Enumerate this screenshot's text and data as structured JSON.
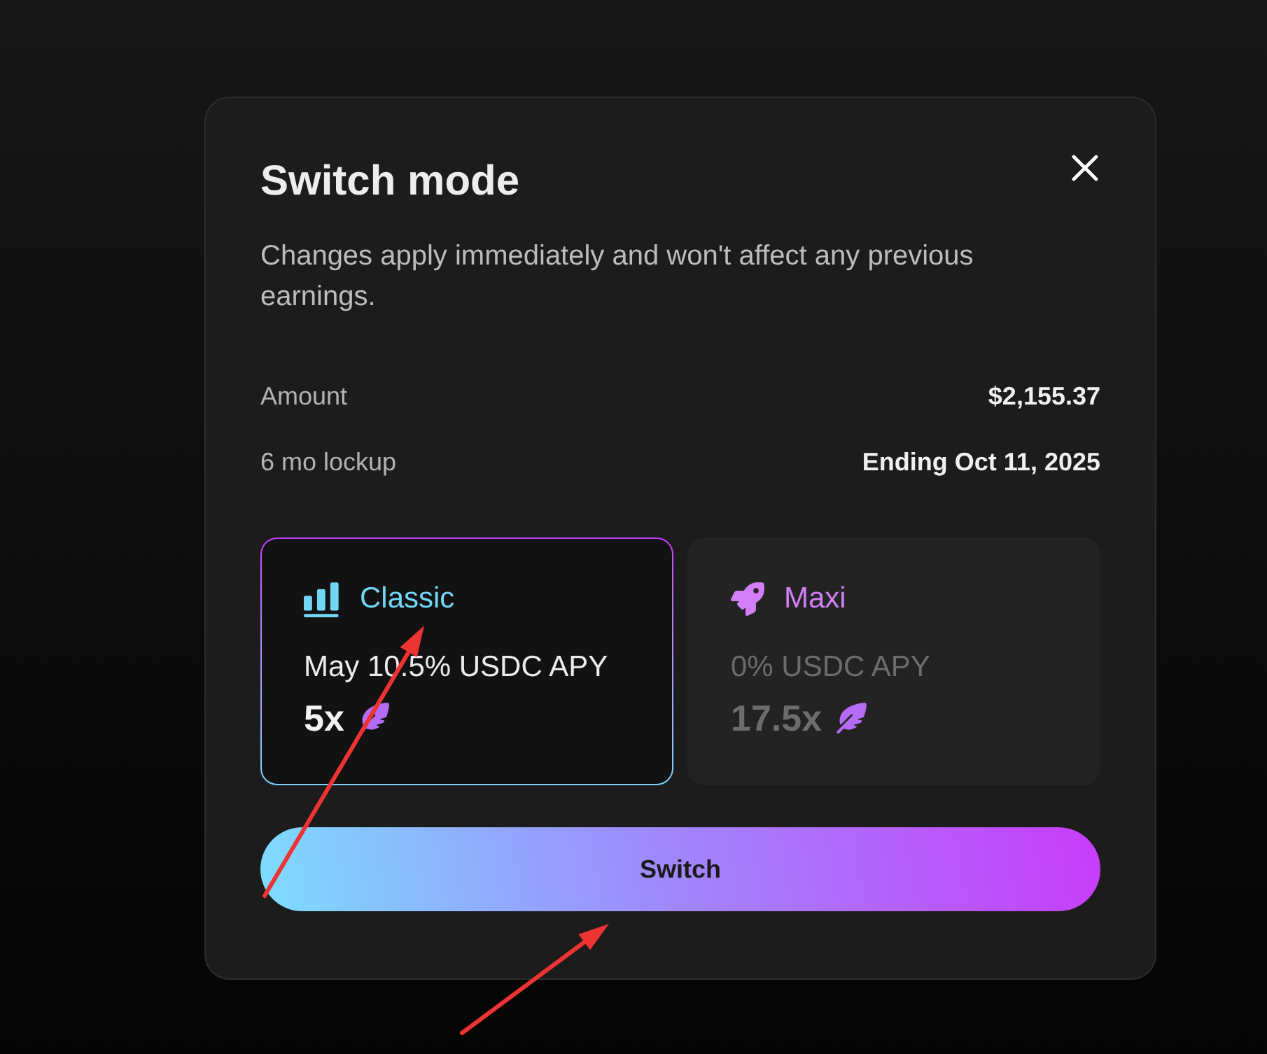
{
  "dialog": {
    "title": "Switch mode",
    "description": "Changes apply immediately and won't affect any previous earnings.",
    "details": [
      {
        "label": "Amount",
        "value": "$2,155.37"
      },
      {
        "label": "6 mo lockup",
        "value": "Ending Oct 11, 2025"
      }
    ],
    "modes": [
      {
        "kind": "classic",
        "name": "Classic",
        "selected": true,
        "apy": "May 10.5% USDC APY",
        "multiplier": "5x"
      },
      {
        "kind": "maxi",
        "name": "Maxi",
        "selected": false,
        "apy": "0% USDC APY",
        "multiplier": "17.5x"
      }
    ],
    "primary_button": "Switch"
  }
}
